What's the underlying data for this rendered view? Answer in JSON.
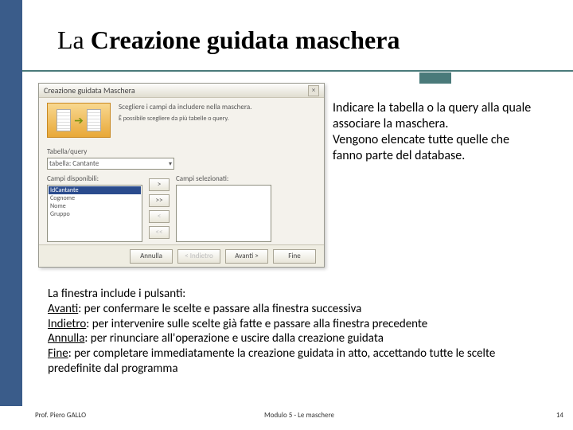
{
  "title": "La Creazione guidata maschera",
  "dialog": {
    "caption": "Creazione guidata Maschera",
    "header_line1": "Scegliere i campi da includere nella maschera.",
    "header_line2": "È possibile scegliere da più tabelle o query.",
    "table_query_label": "Tabella/query",
    "table_query_value": "tabella: Cantante",
    "available_label": "Campi disponibili:",
    "selected_label": "Campi selezionati:",
    "move_add": ">",
    "move_add_all": ">>",
    "move_remove": "<",
    "move_remove_all": "<<",
    "available_items": [
      "IdCantante",
      "Cognome",
      "Nome",
      "Gruppo"
    ],
    "btn_cancel": "Annulla",
    "btn_back": "< Indietro",
    "btn_next": "Avanti >",
    "btn_finish": "Fine"
  },
  "annotation": {
    "p1": "Indicare la tabella o la query alla quale associare la maschera.",
    "p2": "Vengono elencate tutte quelle che fanno parte del database."
  },
  "lower": {
    "intro": "La finestra include i pulsanti:",
    "l1a": "Avanti",
    "l1b": ": per confermare le scelte e passare alla finestra successiva",
    "l2a": "Indietro",
    "l2b": ": per intervenire sulle scelte già fatte e passare alla finestra precedente",
    "l3a": "Annulla",
    "l3b": ": per rinunciare  all'operazione e uscire dalla creazione guidata",
    "l4a": "Fine",
    "l4b": ": per completare  immediatamente la creazione guidata in atto, accettando tutte le scelte predefinite dal programma"
  },
  "footer": {
    "left": "Prof. Piero GALLO",
    "center": "Modulo 5  -   Le maschere",
    "page": "14"
  }
}
